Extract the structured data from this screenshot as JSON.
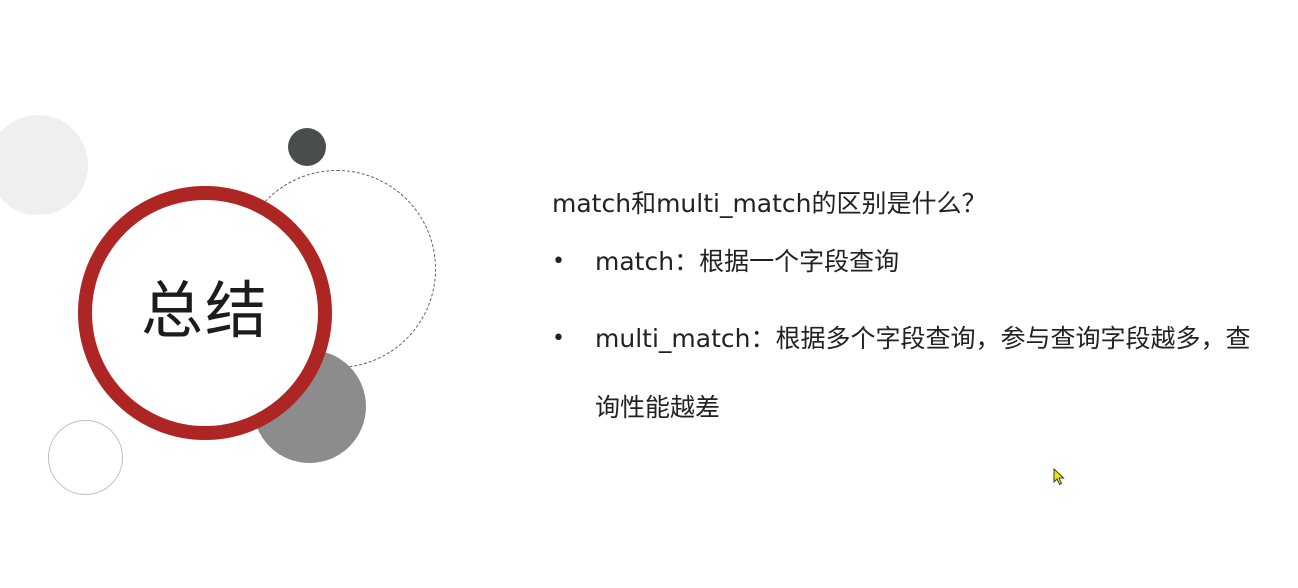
{
  "slide": {
    "title": "总结",
    "question": "match和multi_match的区别是什么？",
    "bullets": [
      {
        "marker": "•",
        "text": "match：根据一个字段查询"
      },
      {
        "marker": "•",
        "text": "multi_match：根据多个字段查询，参与查询字段越多，查询性能越差"
      }
    ],
    "colors": {
      "accent_red": "#ad2623",
      "dark_gray": "#4a4d4d",
      "mid_gray": "#8c8c8c",
      "light_gray": "#efefef"
    },
    "icons": {
      "cursor": "mouse-pointer-icon"
    }
  }
}
